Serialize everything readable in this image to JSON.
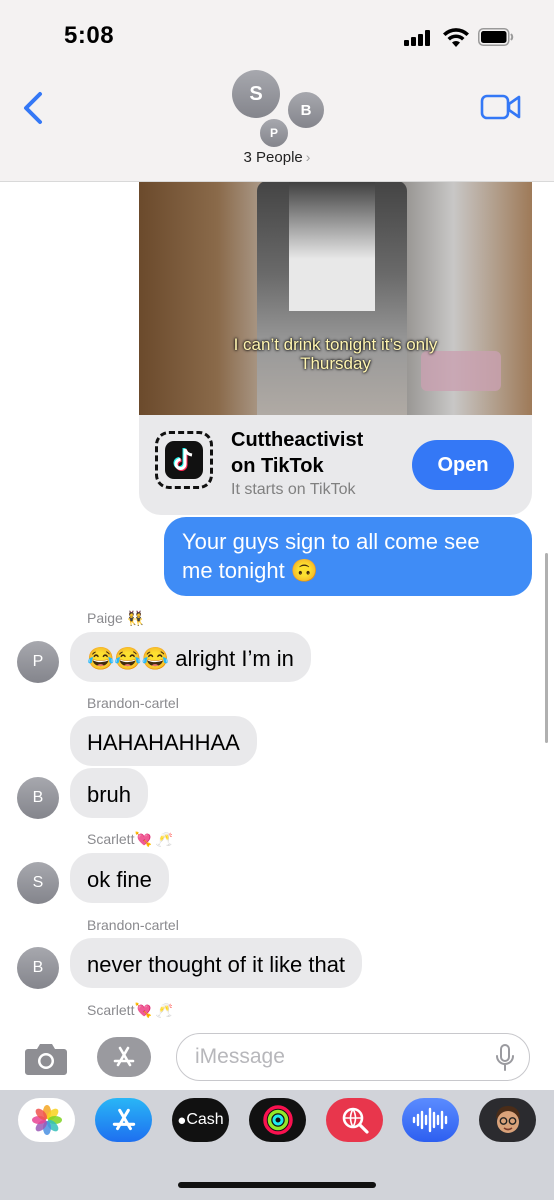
{
  "status_bar": {
    "time": "5:08"
  },
  "header": {
    "avatars": [
      "S",
      "B",
      "P"
    ],
    "group_label": "3 People",
    "chevron": "›"
  },
  "tiktok_card": {
    "video_caption_line1": "I can’t drink tonight it’s only",
    "video_caption_line2": "Thursday",
    "title_line1": "Cuttheactivist",
    "title_line2": "on TikTok",
    "subtitle": "It starts on TikTok",
    "open_label": "Open"
  },
  "messages": {
    "outgoing_1": "Your guys sign to all come see me tonight 🙃",
    "sender_paige": "Paige",
    "paige_1": "alright I’m in",
    "paige_avatar": "P",
    "sender_brandon_1": "Brandon-cartel",
    "brandon_1": "HAHAHAHHAA",
    "brandon_2": "bruh",
    "brandon_avatar": "B",
    "sender_scarlett_1": "Scarlett",
    "scarlett_1": "ok fine",
    "scarlett_avatar": "S",
    "sender_brandon_2": "Brandon-cartel",
    "brandon_3": "never thought of it like that",
    "sender_scarlett_2": "Scarlett"
  },
  "composer": {
    "placeholder": "iMessage"
  },
  "app_drawer": {
    "icons": [
      "photos-icon",
      "app-store-icon",
      "apple-cash-icon",
      "activity-icon",
      "web-images-icon",
      "audio-message-icon",
      "memoji-icon"
    ],
    "cash_label": "Cash"
  },
  "colors": {
    "accent": "#3478f6",
    "outgoing_bubble": "#3f8cf6",
    "incoming_bubble": "#e9e9eb",
    "header_bg": "#f4f2f2",
    "drawer_bg": "#d1d3d9"
  }
}
